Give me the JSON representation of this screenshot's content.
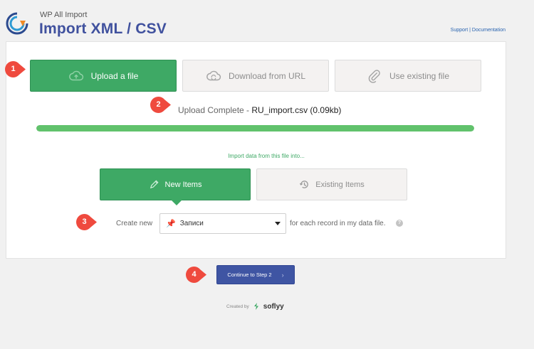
{
  "header": {
    "brand": "WP All Import",
    "title": "Import XML / CSV",
    "support_link": "Support",
    "separator": " | ",
    "documentation_link": "Documentation"
  },
  "upload_tabs": {
    "upload_file": "Upload a file",
    "download_url": "Download from URL",
    "existing_file": "Use existing file",
    "active": "Upload a file"
  },
  "upload_status": {
    "label": "Upload Complete",
    "separator": " - ",
    "file_name": "RU_import.csv (0.09kb)",
    "progress_fraction": 1.0
  },
  "import_into": {
    "heading": "Import data from this file into...",
    "new_items": "New Items",
    "existing_items": "Existing Items",
    "selected": "New Items"
  },
  "create_new": {
    "label": "Create new",
    "selected_value": "Записи",
    "suffix": "for each record in my data file.",
    "help": "?"
  },
  "continue_button": {
    "label": "Continue to Step 2",
    "chevron": "›"
  },
  "footer": {
    "created_by": "Created by",
    "company": "soflyy"
  },
  "annotations": [
    "1",
    "2",
    "3",
    "4"
  ],
  "colors": {
    "primary_green": "#3ea965",
    "progress_green": "#61c26c",
    "title_blue": "#40519e",
    "button_blue": "#3f55a3",
    "marker_red": "#ef4a3e"
  }
}
